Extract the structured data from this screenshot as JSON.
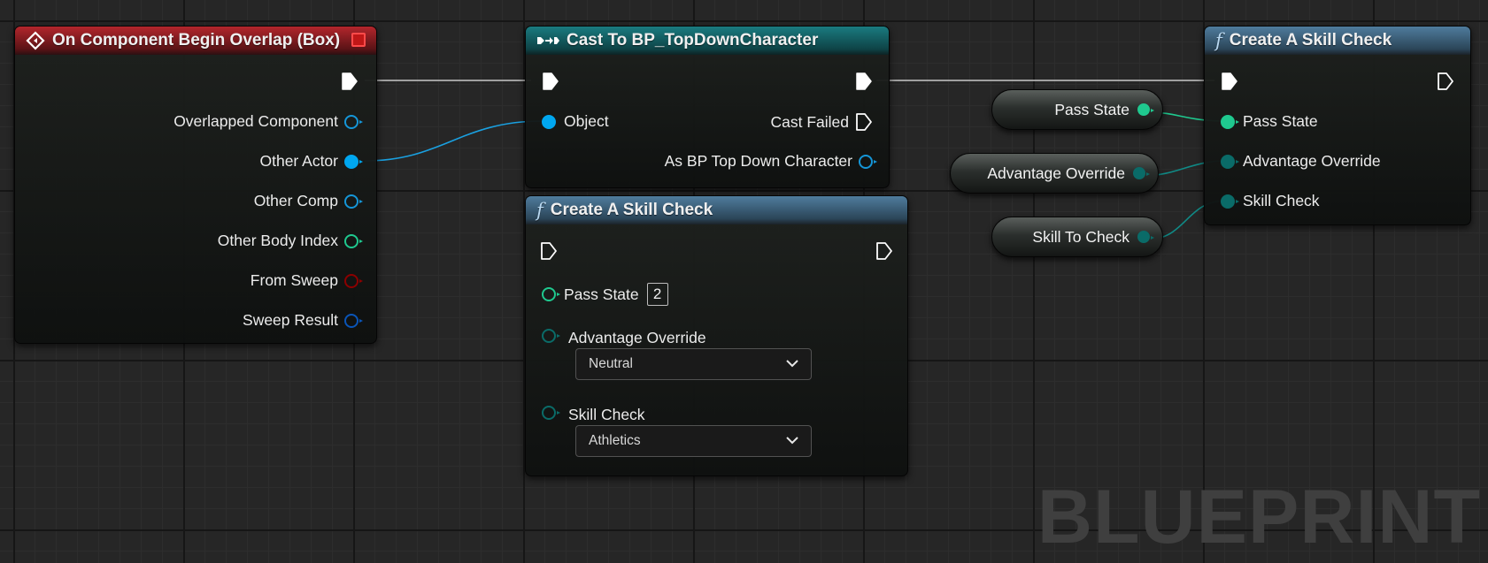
{
  "colors": {
    "exec": "#ffffff",
    "object": "#00a7f0",
    "int": "#1fc98f",
    "enum": "#0a6b68",
    "bool": "#8c0000",
    "struct": "#0a4fa8"
  },
  "event_node": {
    "title": "On Component Begin Overlap (Box)",
    "pins": {
      "overlapped_component": "Overlapped Component",
      "other_actor": "Other Actor",
      "other_comp": "Other Comp",
      "other_body_index": "Other Body Index",
      "from_sweep": "From Sweep",
      "sweep_result": "Sweep Result"
    }
  },
  "cast_node": {
    "title": "Cast To BP_TopDownCharacter",
    "object_pin": "Object",
    "cast_failed": "Cast Failed",
    "as_character": "As BP Top Down Character"
  },
  "skill_node_lower": {
    "title": "Create A Skill Check",
    "pass_state_label": "Pass State",
    "pass_state_value": "2",
    "advantage_label": "Advantage Override",
    "advantage_value": "Neutral",
    "skill_label": "Skill Check",
    "skill_value": "Athletics"
  },
  "skill_node_upper": {
    "title": "Create A Skill Check",
    "pass_state": "Pass State",
    "advantage_override": "Advantage Override",
    "skill_check": "Skill Check"
  },
  "variables": {
    "pass_state": "Pass State",
    "advantage_override": "Advantage Override",
    "skill_to_check": "Skill To Check"
  },
  "watermark": "BLUEPRINT"
}
